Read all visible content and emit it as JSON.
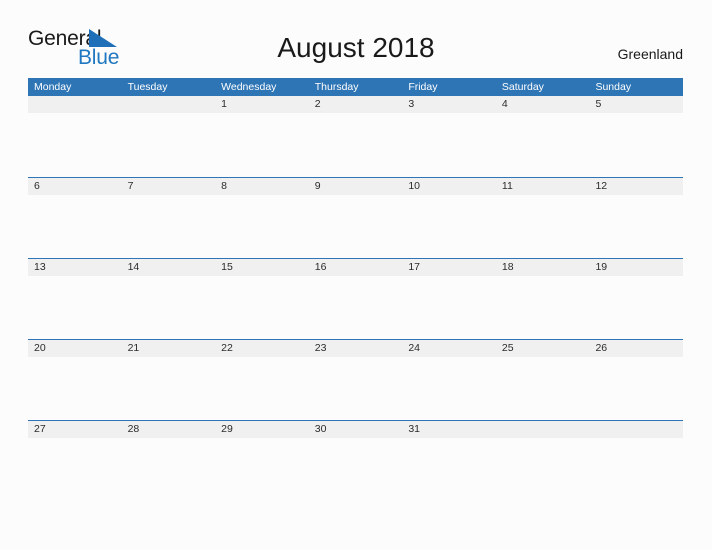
{
  "brand": {
    "name_part1": "General",
    "name_part2": "Blue",
    "mark_icon": "triangle-flag-icon",
    "color_primary": "#1f78c1",
    "color_text": "#1a1a1a"
  },
  "header": {
    "title": "August 2018",
    "locale": "Greenland"
  },
  "calendar": {
    "month": "August",
    "year": "2018",
    "accent_color": "#2e75b6",
    "band_color": "#f0f0f0",
    "weekday_headers": [
      "Monday",
      "Tuesday",
      "Wednesday",
      "Thursday",
      "Friday",
      "Saturday",
      "Sunday"
    ],
    "weeks": [
      [
        "",
        "",
        "1",
        "2",
        "3",
        "4",
        "5"
      ],
      [
        "6",
        "7",
        "8",
        "9",
        "10",
        "11",
        "12"
      ],
      [
        "13",
        "14",
        "15",
        "16",
        "17",
        "18",
        "19"
      ],
      [
        "20",
        "21",
        "22",
        "23",
        "24",
        "25",
        "26"
      ],
      [
        "27",
        "28",
        "29",
        "30",
        "31",
        "",
        ""
      ]
    ]
  }
}
